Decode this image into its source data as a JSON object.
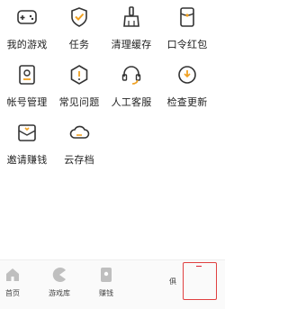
{
  "menu": {
    "items": [
      {
        "label": "我的游戏",
        "icon": "gamepad-icon"
      },
      {
        "label": "任务",
        "icon": "shield-check-icon"
      },
      {
        "label": "清理缓存",
        "icon": "broom-icon"
      },
      {
        "label": "口令红包",
        "icon": "red-envelope-icon"
      },
      {
        "label": "帐号管理",
        "icon": "account-card-icon"
      },
      {
        "label": "常见问题",
        "icon": "hexagon-info-icon"
      },
      {
        "label": "人工客服",
        "icon": "headset-icon"
      },
      {
        "label": "检查更新",
        "icon": "update-icon"
      },
      {
        "label": "邀请赚钱",
        "icon": "invite-envelope-icon"
      },
      {
        "label": "云存档",
        "icon": "cloud-icon"
      }
    ]
  },
  "tabbar": {
    "tabs": [
      {
        "label": "首页",
        "icon": "home-icon"
      },
      {
        "label": "游戏库",
        "icon": "pacman-icon"
      },
      {
        "label": "赚钱",
        "icon": "envelope-coin-icon"
      },
      {
        "label": "俱",
        "icon": "group-icon"
      }
    ]
  },
  "colors": {
    "accent": "#f0a020",
    "icon_stroke": "#333333",
    "highlight_border": "#e04040"
  }
}
